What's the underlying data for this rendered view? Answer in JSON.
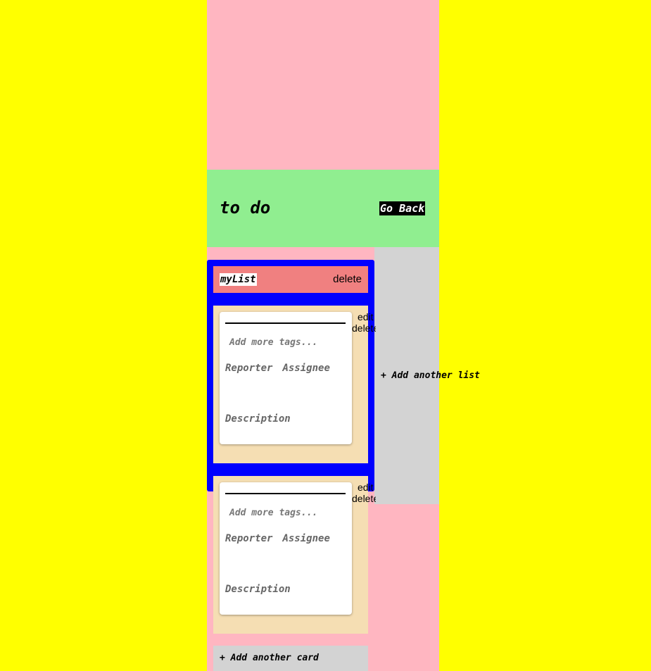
{
  "header": {
    "title": "to do",
    "go_back_label": "Go Back"
  },
  "list": {
    "name": "myList",
    "delete_label": "delete",
    "cards": [
      {
        "tags_placeholder": "Add more tags...",
        "reporter_label": "Reporter",
        "assignee_label": "Assignee",
        "description_label": "Description",
        "edit_label": "edit",
        "delete_label": "delete"
      },
      {
        "tags_placeholder": "Add more tags...",
        "reporter_label": "Reporter",
        "assignee_label": "Assignee",
        "description_label": "Description",
        "edit_label": "edit",
        "delete_label": "delete"
      }
    ],
    "add_card_label": "+ Add another card"
  },
  "add_list_label": "+ Add another list",
  "colors": {
    "page_background": "#ffff00",
    "column_background": "#ffb6c1",
    "header_background": "#90ee90",
    "list_frame": "#0000ff",
    "list_header": "#f08080",
    "card_container": "#f5deb3",
    "add_panel": "#d3d3d3"
  }
}
